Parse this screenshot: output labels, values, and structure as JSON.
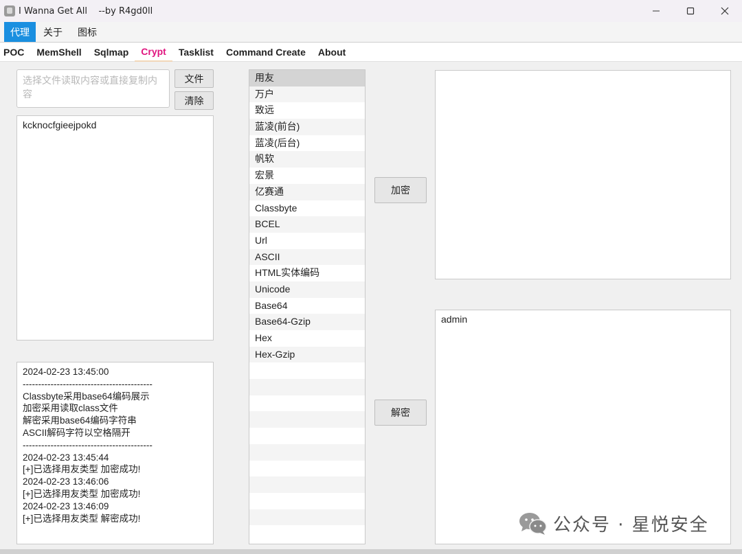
{
  "window": {
    "title": "I Wanna Get All    --by R4gd0ll",
    "min_icon": "minimize-icon",
    "max_icon": "maximize-icon",
    "close_icon": "close-icon"
  },
  "menu": {
    "items": [
      {
        "label": "代理",
        "active": true
      },
      {
        "label": "关于",
        "active": false
      },
      {
        "label": "图标",
        "active": false
      }
    ]
  },
  "tabs": {
    "items": [
      {
        "label": "POC",
        "active": false
      },
      {
        "label": "MemShell",
        "active": false
      },
      {
        "label": "Sqlmap",
        "active": false
      },
      {
        "label": "Crypt",
        "active": true
      },
      {
        "label": "Tasklist",
        "active": false
      },
      {
        "label": "Command Create",
        "active": false
      },
      {
        "label": "About",
        "active": false
      }
    ],
    "active_color": "#e0157f"
  },
  "input": {
    "placeholder": "选择文件读取内容或直接复制内容",
    "file_button": "文件",
    "clear_button": "清除",
    "main_text": "kcknocfgieejpokd"
  },
  "log": {
    "lines": [
      "2024-02-23 13:45:00",
      "------------------------------------------",
      "Classbyte采用base64编码展示",
      "加密采用读取class文件",
      "解密采用base64编码字符串",
      "ASCII解码字符以空格隔开",
      "------------------------------------------",
      "2024-02-23 13:45:44",
      "[+]已选择用友类型 加密成功!",
      "2024-02-23 13:46:06",
      "[+]已选择用友类型 加密成功!",
      "2024-02-23 13:46:09",
      "[+]已选择用友类型 解密成功!"
    ]
  },
  "list": {
    "items": [
      "用友",
      "万户",
      "致远",
      "蓝凌(前台)",
      "蓝凌(后台)",
      "帆软",
      "宏景",
      "亿赛通",
      "Classbyte",
      "BCEL",
      "Url",
      "ASCII",
      "HTML实体编码",
      "Unicode",
      "Base64",
      "Base64-Gzip",
      "Hex",
      "Hex-Gzip"
    ],
    "selected": "用友"
  },
  "actions": {
    "encrypt": "加密",
    "decrypt": "解密"
  },
  "output": {
    "top_text": "",
    "bottom_text": "admin"
  },
  "watermark": {
    "text": "公众号 · 星悦安全",
    "icon": "wechat-icon"
  }
}
